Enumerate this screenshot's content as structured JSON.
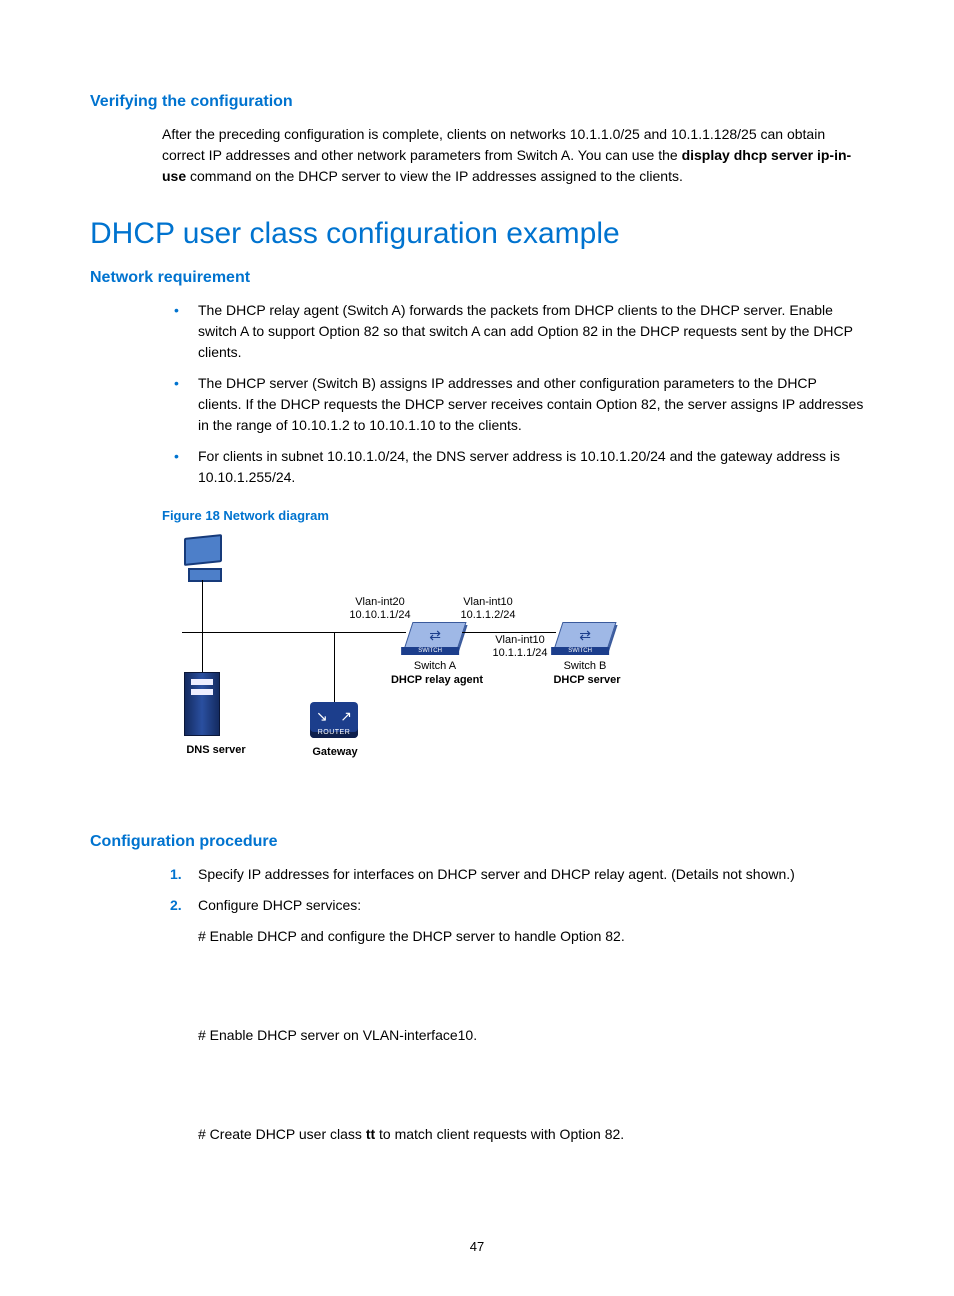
{
  "page_number": "47",
  "sections": {
    "verify": {
      "heading": "Verifying the configuration",
      "para_pre": "After the preceding configuration is complete, clients on networks 10.1.1.0/25 and 10.1.1.128/25 can obtain correct IP addresses and other network parameters from Switch A. You can use the ",
      "cmd": "display dhcp server ip-in-use",
      "para_post": " command on the DHCP server to view the IP addresses assigned to the clients."
    },
    "title": "DHCP user class configuration example",
    "netreq": {
      "heading": "Network requirement",
      "bullets": [
        "The DHCP relay agent (Switch A) forwards the packets from DHCP clients to the DHCP server. Enable switch A to support Option 82 so that switch A can add Option 82 in the DHCP requests sent by the DHCP clients.",
        "The DHCP server (Switch B) assigns IP addresses and other configuration parameters to the DHCP clients. If the DHCP requests the DHCP server receives contain Option 82, the server assigns IP addresses in the range of 10.10.1.2 to 10.10.1.10 to the clients.",
        "For clients in subnet 10.10.1.0/24, the DNS server address is 10.10.1.20/24 and the gateway address is 10.10.1.255/24."
      ]
    },
    "figure": {
      "caption": "Figure 18 Network diagram",
      "labels": {
        "vlan20": "Vlan-int20",
        "ip20": "10.10.1.1/24",
        "vlan10a": "Vlan-int10",
        "ip10a": "10.1.1.2/24",
        "vlan10b": "Vlan-int10",
        "ip10b": "10.1.1.1/24",
        "switchA": "Switch A",
        "relay": "DHCP relay agent",
        "switchB": "Switch B",
        "server": "DHCP server",
        "dns": "DNS server",
        "gateway": "Gateway"
      }
    },
    "config": {
      "heading": "Configuration procedure",
      "steps": [
        "Specify IP addresses for interfaces on DHCP server and DHCP relay agent. (Details not shown.)",
        "Configure DHCP services:"
      ],
      "substeps": {
        "a": "# Enable DHCP and configure the DHCP server to handle Option 82.",
        "b": "# Enable DHCP server on VLAN-interface10.",
        "c_pre": "# Create DHCP user class ",
        "c_bold": "tt",
        "c_post": " to match client requests with Option 82."
      }
    }
  }
}
